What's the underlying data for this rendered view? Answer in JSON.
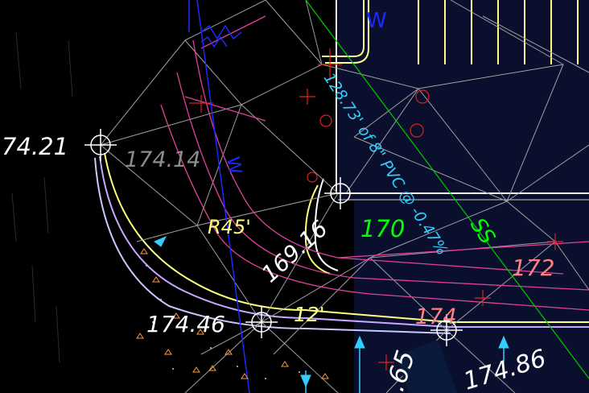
{
  "canvas": {
    "background": "#000000",
    "site_area_fill": "#0a0f2e"
  },
  "labels": {
    "elev_left": "74.21",
    "elev_gray": "174.14",
    "radius": "R45'",
    "elev_rot": "169.16",
    "contour_170": "170",
    "pipe_note": "128.73' of 8\" PVC @ -0.47%",
    "ss": "SS",
    "contour_172": "172",
    "elev_bottom_left": "174.46",
    "dim_12": "12'",
    "contour_174": "174",
    "elev_bottom_right": "174.86",
    "elev_partial": ".65",
    "w_top": "W",
    "w_rot": "W"
  },
  "colors": {
    "white": "#ffffff",
    "gray_label": "#8c8c8c",
    "yellow": "#ffff80",
    "green": "#00ff00",
    "cyan": "#33ccff",
    "pink": "#ff8080",
    "blue_line": "#1a2aff",
    "magenta": "#e0409c",
    "red": "#e02020",
    "gray_line": "#a0a0a0",
    "orange": "#ff9a3c"
  }
}
